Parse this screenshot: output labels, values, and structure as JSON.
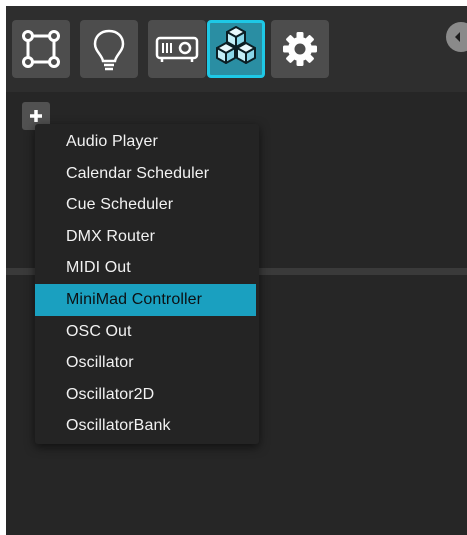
{
  "colors": {
    "accent": "#1aa0c0",
    "active_tool_border": "#1ec8e6",
    "panel_bg": "#262626",
    "toolbar_button_bg": "#4d4d4d"
  },
  "toolbar": {
    "buttons": [
      {
        "icon": "surface-quad-icon",
        "active": false
      },
      {
        "icon": "lightbulb-icon",
        "active": false
      },
      {
        "icon": "projector-icon",
        "active": false
      },
      {
        "icon": "cubes-icon",
        "active": true
      },
      {
        "icon": "gear-icon",
        "active": false
      }
    ],
    "side_toggle_icon": "chevron-left-icon"
  },
  "add_button": {
    "icon": "plus-icon"
  },
  "menu": {
    "items": [
      "Audio Player",
      "Calendar Scheduler",
      "Cue Scheduler",
      "DMX Router",
      "MIDI Out",
      "MiniMad Controller",
      "OSC Out",
      "Oscillator",
      "Oscillator2D",
      "OscillatorBank"
    ],
    "selected": "MiniMad Controller"
  }
}
